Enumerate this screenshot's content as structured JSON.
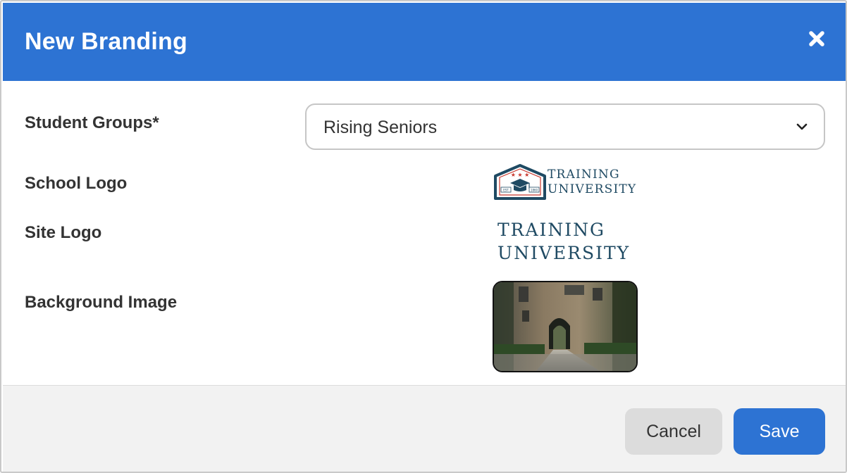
{
  "dialog": {
    "title": "New Branding",
    "close_icon": "close-icon"
  },
  "form": {
    "student_groups": {
      "label": "Student Groups*",
      "selected": "Rising Seniors"
    },
    "school_logo": {
      "label": "School Logo",
      "logo_text_line1": "TRAINING",
      "logo_text_line2": "UNIVERSITY",
      "badge_left": "EST",
      "badge_right": "1860"
    },
    "site_logo": {
      "label": "Site Logo",
      "logo_text_line1": "TRAINING",
      "logo_text_line2": "UNIVERSITY"
    },
    "background_image": {
      "label": "Background Image"
    }
  },
  "footer": {
    "cancel_label": "Cancel",
    "save_label": "Save"
  },
  "colors": {
    "header": "#2d73d3",
    "primary_button": "#2d73d3",
    "logo_navy": "#1f4a63",
    "logo_red": "#c8372d"
  }
}
